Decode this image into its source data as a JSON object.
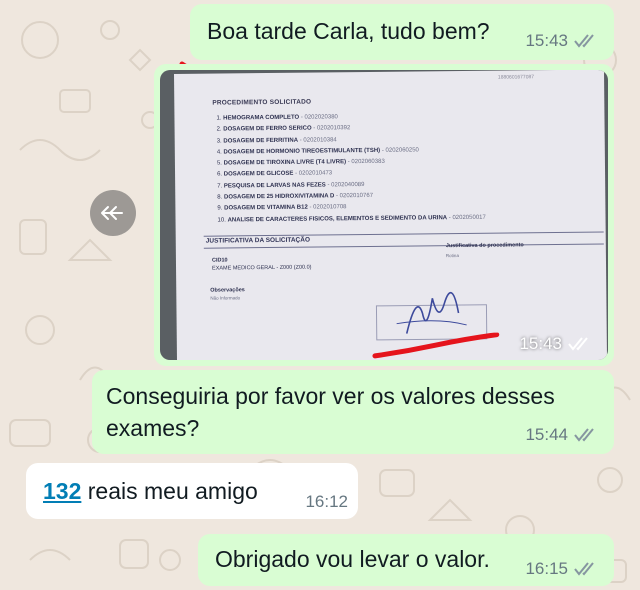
{
  "colors": {
    "outgoing_bubble": "#d9fdd3",
    "incoming_bubble": "#ffffff",
    "wallpaper": "#efe7de",
    "link": "#027eb5",
    "red_annotation": "#e5141c"
  },
  "messages": [
    {
      "text": "Boa tarde Carla, tudo bem?",
      "time": "15:43",
      "status_icon": "double-check-icon"
    },
    {
      "time": "15:43",
      "status_icon": "double-check-icon"
    },
    {
      "text_line1": "Conseguiria por favor ver os valores desses",
      "text_line2": "exames?",
      "time": "15:44",
      "status_icon": "double-check-icon"
    },
    {
      "number": "132",
      "text": " reais meu amigo",
      "time": "16:12"
    },
    {
      "text": "Obrigado vou levar o valor.",
      "time": "16:15",
      "status_icon": "double-check-icon"
    }
  ],
  "forward_icon": "forward-arrow-icon",
  "document": {
    "top_number": "1880601677087",
    "heading": "PROCEDIMENTO SOLICITADO",
    "items": [
      {
        "num": "1.",
        "name": "HEMOGRAMA COMPLETO",
        "code": " - 0202020380"
      },
      {
        "num": "2.",
        "name": "DOSAGEM DE FERRO SERICO",
        "code": " - 0202010392"
      },
      {
        "num": "3.",
        "name": "DOSAGEM DE FERRITINA",
        "code": " - 0202010384"
      },
      {
        "num": "4.",
        "name": "DOSAGEM DE HORMONIO TIREOESTIMULANTE (TSH)",
        "code": " - 0202060250"
      },
      {
        "num": "5.",
        "name": "DOSAGEM DE TIROXINA LIVRE (T4 LIVRE)",
        "code": " - 0202060383"
      },
      {
        "num": "6.",
        "name": "DOSAGEM DE GLICOSE",
        "code": " - 0202010473"
      },
      {
        "num": "7.",
        "name": "PESQUISA DE LARVAS NAS FEZES",
        "code": " - 0202040089"
      },
      {
        "num": "8.",
        "name": "DOSAGEM DE 25 HIDROXIVITAMINA D",
        "code": " - 0202010767"
      },
      {
        "num": "9.",
        "name": "DOSAGEM DE VITAMINA B12",
        "code": " - 0202010708"
      },
      {
        "num": "10.",
        "name": "ANALISE DE CARACTERES FISICOS, ELEMENTOS E SEDIMENTO DA URINA",
        "code": " - 0202050017"
      }
    ],
    "justification_heading": "JUSTIFICATIVA DA SOLICITAÇÃO",
    "cid_label": "CID10",
    "cid_value": "EXAME MEDICO GERAL - Z000 (Z00.0)",
    "justification_proc_label": "Justificativa do procedimento",
    "justification_proc_value": "Rotina",
    "observations_label": "Observações",
    "observations_value": "Não Informado"
  }
}
